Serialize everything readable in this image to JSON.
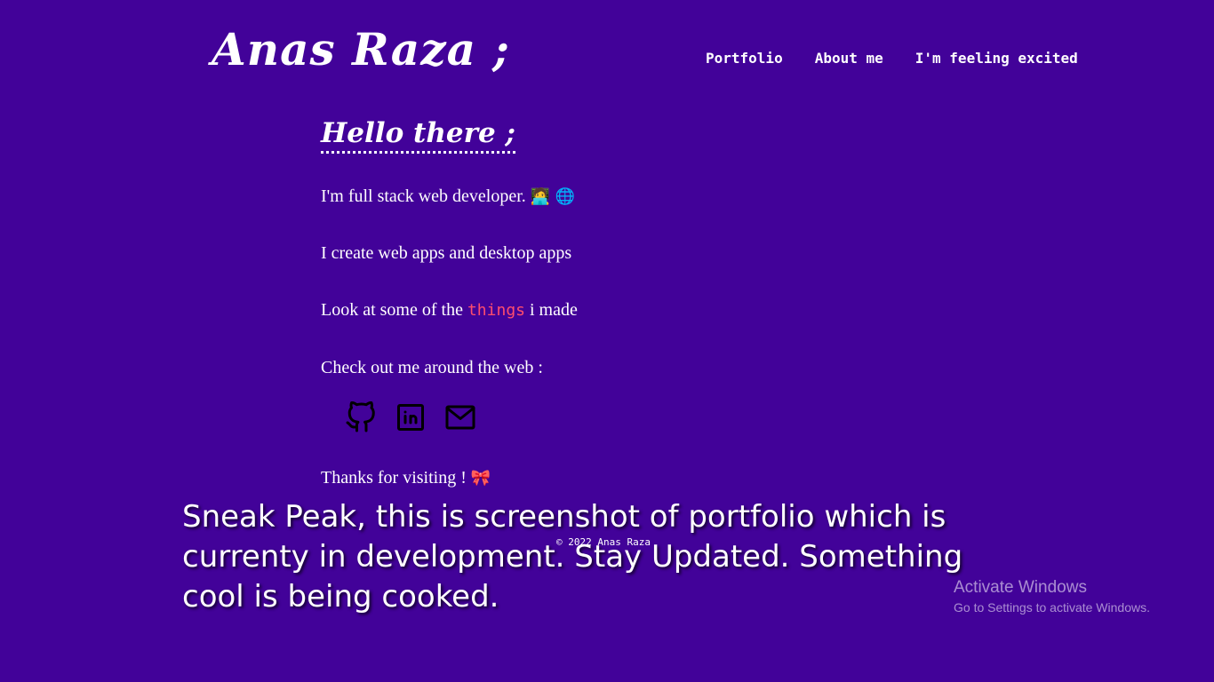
{
  "header": {
    "logo": "Anas Raza ;",
    "nav": [
      {
        "label": "Portfolio"
      },
      {
        "label": "About me"
      },
      {
        "label": "I'm feeling excited"
      }
    ]
  },
  "intro": {
    "heading": "Hello there ;",
    "line1": "I'm full stack web developer.",
    "line1_emoji": "🧑‍💻 🌐",
    "line2": "I create web apps and desktop apps",
    "line3_before": "Look at some of the",
    "line3_link": "things",
    "line3_after": "i made",
    "line4": "Check out me around the web :",
    "social": [
      "github-icon",
      "linkedin-icon",
      "mail-icon"
    ],
    "line5": "Thanks for visiting !",
    "line5_emoji": "🎀"
  },
  "footer": {
    "copyright": "© 2022 Anas Raza"
  },
  "overlay": {
    "text": "Sneak Peak, this is screenshot of portfolio which is currenty in development. Stay Updated. Something cool is being cooked."
  },
  "windows_watermark": {
    "title": "Activate Windows",
    "subtitle": "Go to Settings to activate Windows."
  },
  "colors": {
    "background": "#420299",
    "accent": "#ff4d6d",
    "text": "#ffffff"
  }
}
